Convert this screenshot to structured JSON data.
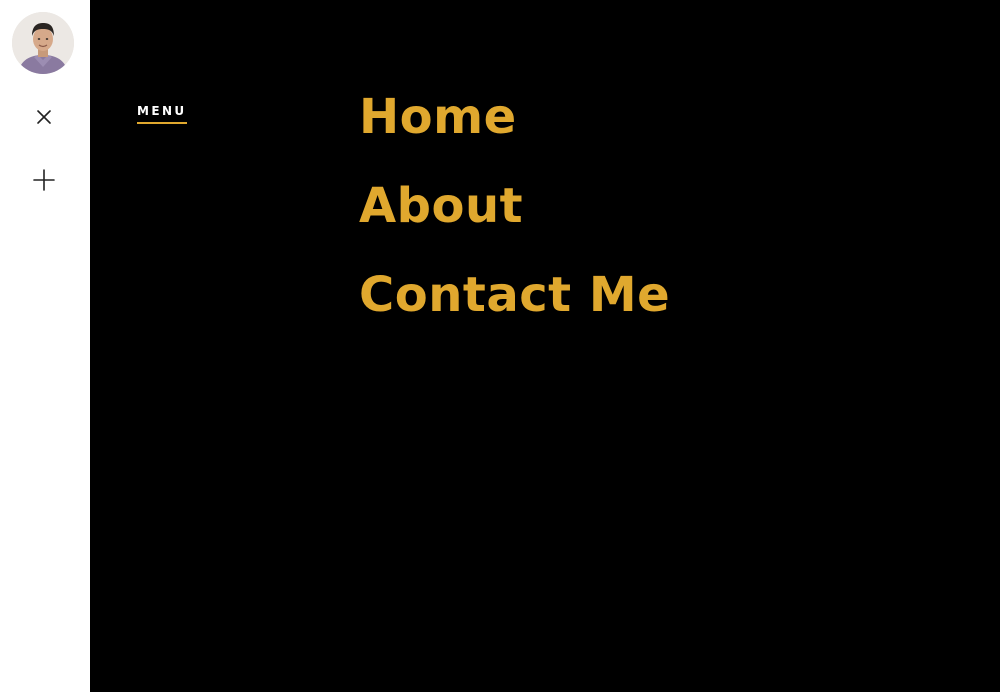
{
  "sidebar": {
    "avatar_alt": "profile photo",
    "close_icon": "close-icon",
    "plus_icon": "plus-icon"
  },
  "menu": {
    "label": "MENU",
    "items": [
      {
        "label": "Home"
      },
      {
        "label": "About"
      },
      {
        "label": "Contact Me"
      }
    ]
  },
  "colors": {
    "accent": "#e0a82e",
    "overlay_bg": "#000000",
    "sidebar_bg": "#ffffff",
    "menu_label": "#ffffff"
  }
}
